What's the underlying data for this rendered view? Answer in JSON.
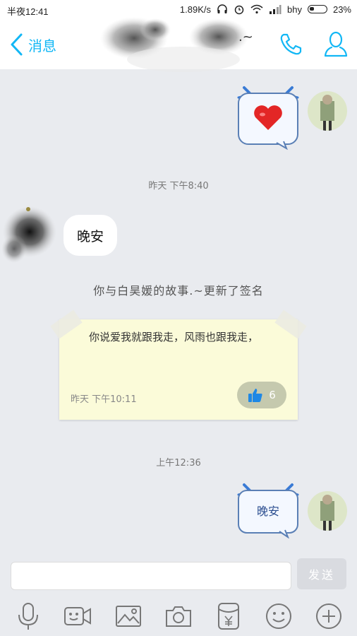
{
  "status_bar": {
    "time": "半夜12:41",
    "network_speed": "1.89K/s",
    "carrier": "bhy",
    "battery": "23%"
  },
  "header": {
    "back_label": "消息",
    "contact_name_suffix": ".~"
  },
  "messages": {
    "ts1": "昨天 下午8:40",
    "received_text": "晚安",
    "system_text": "你与白昊媛的故事.~更新了签名",
    "signature_text": "你说爱我就跟我走，风雨也跟我走，",
    "signature_time": "昨天 下午10:11",
    "like_count": "6",
    "ts2": "上午12:36",
    "sent_text": "晚安"
  },
  "input": {
    "send_label": "发送"
  },
  "colors": {
    "accent": "#12b7f5",
    "background": "#e9ebef",
    "note": "#fbfbd9"
  },
  "icons": [
    "back-chevron-icon",
    "phone-icon",
    "profile-icon",
    "heart-icon",
    "thumbs-up-icon",
    "microphone-icon",
    "video-icon",
    "image-icon",
    "camera-icon",
    "red-packet-icon",
    "emoji-icon",
    "plus-icon"
  ]
}
